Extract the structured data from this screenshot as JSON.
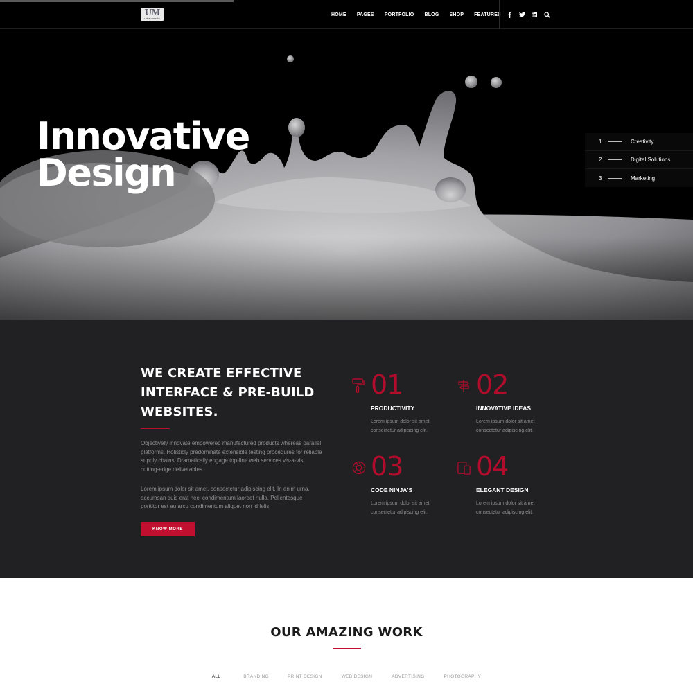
{
  "header": {
    "logo_text": "UM",
    "logo_sub": "urban media",
    "nav": [
      "HOME",
      "PAGES",
      "PORTFOLIO",
      "BLOG",
      "SHOP",
      "FEATURES"
    ],
    "icons": [
      "facebook-icon",
      "twitter-icon",
      "linkedin-icon",
      "search-icon"
    ]
  },
  "hero": {
    "title_line1": "Innovative",
    "title_line2": "Design",
    "slides": [
      {
        "num": "1",
        "label": "Creativity"
      },
      {
        "num": "2",
        "label": "Digital Solutions"
      },
      {
        "num": "3",
        "label": "Marketing"
      }
    ]
  },
  "about": {
    "heading_lines": [
      "WE CREATE EFFECTIVE",
      "INTERFACE & PRE-BUILD",
      "WEBSITES."
    ],
    "para1_lines": [
      "Objectively innovate empowered manufactured products whereas parallel",
      "platforms. Holisticly predominate extensible testing procedures for reliable",
      "supply chains. Dramatically engage top-line web services vis-a-vis",
      "cutting-edge deliverables."
    ],
    "para2_lines": [
      "Lorem ipsum dolor sit amet, consectetur adipiscing elit. In enim urna,",
      "accumsan quis erat nec, condimentum laoreet nulla. Pellentesque",
      "porttitor est eu arcu condimentum aliquet non id felis."
    ],
    "button": "KNOW MORE"
  },
  "features": [
    {
      "num": "01",
      "title": "PRODUCTIVITY",
      "icon": "paint-roller-icon",
      "desc": [
        "Lorem ipsum dolor sit amet",
        "consectetur adipiscing elit."
      ]
    },
    {
      "num": "02",
      "title": "INNOVATIVE IDEAS",
      "icon": "signpost-icon",
      "desc": [
        "Lorem ipsum dolor sit amet",
        "consectetur adipiscing elit."
      ]
    },
    {
      "num": "03",
      "title": "CODE NINJA'S",
      "icon": "aperture-icon",
      "desc": [
        "Lorem ipsum dolor sit amet",
        "consectetur adipiscing elit."
      ]
    },
    {
      "num": "04",
      "title": "ELEGANT DESIGN",
      "icon": "devices-icon",
      "desc": [
        "Lorem ipsum dolor sit amet",
        "consectetur adipiscing elit."
      ]
    }
  ],
  "work": {
    "title": "OUR AMAZING WORK",
    "filters": [
      "ALL",
      "BRANDING",
      "PRINT DESIGN",
      "WEB DESIGN",
      "ADVERTISING",
      "PHOTOGRAPHY"
    ],
    "active_filter": "ALL"
  },
  "colors": {
    "accent": "#c20e2f",
    "dark_section": "#212022",
    "hero_bg": "#000000"
  }
}
